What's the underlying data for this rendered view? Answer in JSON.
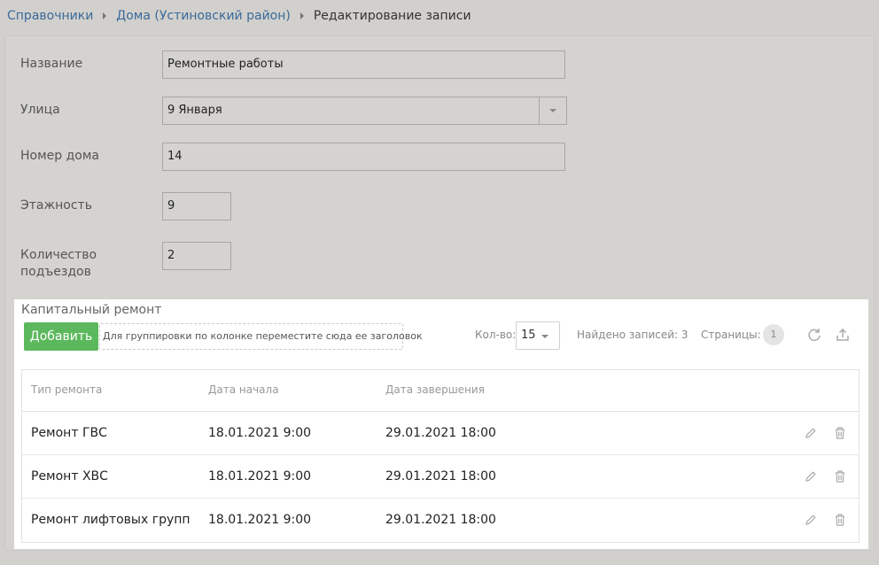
{
  "breadcrumb": {
    "items": [
      "Справочники",
      "Дома (Устиновский район)"
    ],
    "current": "Редактирование записи"
  },
  "form": {
    "name": {
      "label": "Название",
      "value": "Ремонтные работы"
    },
    "street": {
      "label": "Улица",
      "value": "9 Января"
    },
    "house_number": {
      "label": "Номер дома",
      "value": "14"
    },
    "floors": {
      "label": "Этажность",
      "value": "9"
    },
    "entrances": {
      "label_line1": "Количество",
      "label_line2": "подъездов",
      "value": "2"
    }
  },
  "repairs": {
    "title": "Капитальный ремонт",
    "add_label": "Добавить",
    "group_hint": "Для группировки по колонке переместите сюда ее заголовок",
    "count_label": "Кол-во:",
    "count_value": "15",
    "found_label": "Найдено записей: 3",
    "pages_label": "Страницы:",
    "page_current": "1",
    "icons": {
      "refresh": "refresh-icon",
      "export": "export-icon",
      "edit": "pencil-icon",
      "delete": "trash-icon"
    },
    "columns": [
      "Тип ремонта",
      "Дата начала",
      "Дата завершения"
    ],
    "rows": [
      {
        "type": "Ремонт ГВС",
        "start": "18.01.2021 9:00",
        "end": "29.01.2021 18:00"
      },
      {
        "type": "Ремонт ХВС",
        "start": "18.01.2021 9:00",
        "end": "29.01.2021 18:00"
      },
      {
        "type": "Ремонт лифтовых групп",
        "start": "18.01.2021 9:00",
        "end": "29.01.2021 18:00"
      }
    ]
  },
  "colors": {
    "accent_green": "#5cb85c",
    "link_blue": "#3a6a9a",
    "background": "#d2d0cd"
  }
}
